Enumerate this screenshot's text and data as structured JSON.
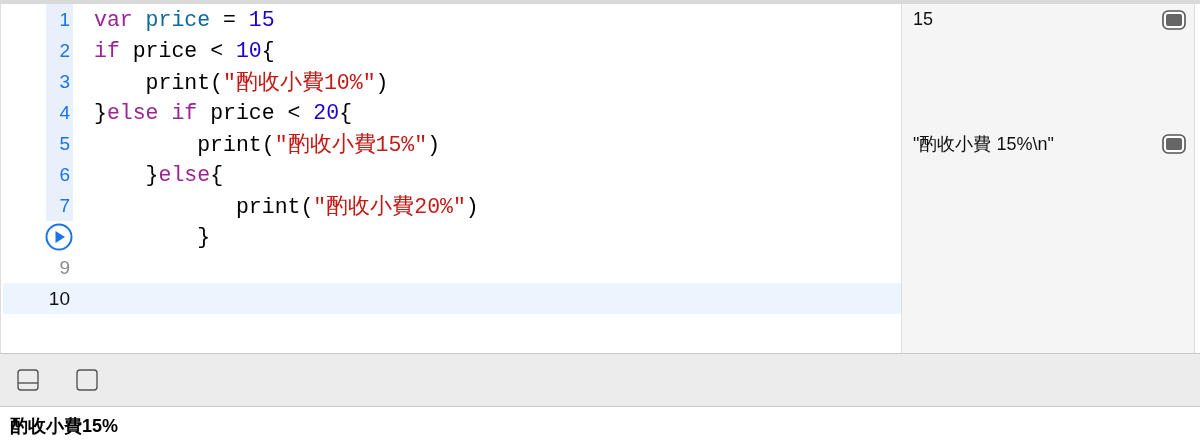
{
  "editor": {
    "lines": [
      {
        "number": "1",
        "kind": "executed",
        "selected": false,
        "tokens": [
          {
            "kind": "keyword",
            "text": "var "
          },
          {
            "kind": "declaration",
            "text": "price"
          },
          {
            "kind": "plain",
            "text": " = "
          },
          {
            "kind": "number",
            "text": "15"
          }
        ],
        "result": "15"
      },
      {
        "number": "2",
        "kind": "executed",
        "selected": false,
        "tokens": [
          {
            "kind": "keyword",
            "text": "if"
          },
          {
            "kind": "plain",
            "text": " price < "
          },
          {
            "kind": "number",
            "text": "10"
          },
          {
            "kind": "plain",
            "text": "{"
          }
        ]
      },
      {
        "number": "3",
        "kind": "executed",
        "selected": false,
        "tokens": [
          {
            "kind": "plain",
            "text": "    print("
          },
          {
            "kind": "string",
            "text": "\"酌收小費10%\""
          },
          {
            "kind": "plain",
            "text": ")"
          }
        ]
      },
      {
        "number": "4",
        "kind": "executed",
        "selected": false,
        "tokens": [
          {
            "kind": "plain",
            "text": "}"
          },
          {
            "kind": "keyword",
            "text": "else if"
          },
          {
            "kind": "plain",
            "text": " price < "
          },
          {
            "kind": "number",
            "text": "20"
          },
          {
            "kind": "plain",
            "text": "{"
          }
        ]
      },
      {
        "number": "5",
        "kind": "executed",
        "selected": false,
        "tokens": [
          {
            "kind": "plain",
            "text": "        print("
          },
          {
            "kind": "string",
            "text": "\"酌收小費15%\""
          },
          {
            "kind": "plain",
            "text": ")"
          }
        ],
        "result": "\"酌收小費 15%\\n\""
      },
      {
        "number": "6",
        "kind": "executed",
        "selected": false,
        "tokens": [
          {
            "kind": "plain",
            "text": "    }"
          },
          {
            "kind": "keyword",
            "text": "else"
          },
          {
            "kind": "plain",
            "text": "{"
          }
        ]
      },
      {
        "number": "7",
        "kind": "executed",
        "selected": false,
        "tokens": [
          {
            "kind": "plain",
            "text": "           print("
          },
          {
            "kind": "string",
            "text": "\"酌收小費20%\""
          },
          {
            "kind": "plain",
            "text": ")"
          }
        ]
      },
      {
        "kind": "run",
        "selected": false,
        "tokens": [
          {
            "kind": "plain",
            "text": "        }"
          }
        ]
      },
      {
        "number": "9",
        "kind": "plain",
        "selected": false
      },
      {
        "number": "10",
        "kind": "plain",
        "selected": true
      }
    ]
  },
  "console": {
    "output": "酌收小費15%"
  }
}
